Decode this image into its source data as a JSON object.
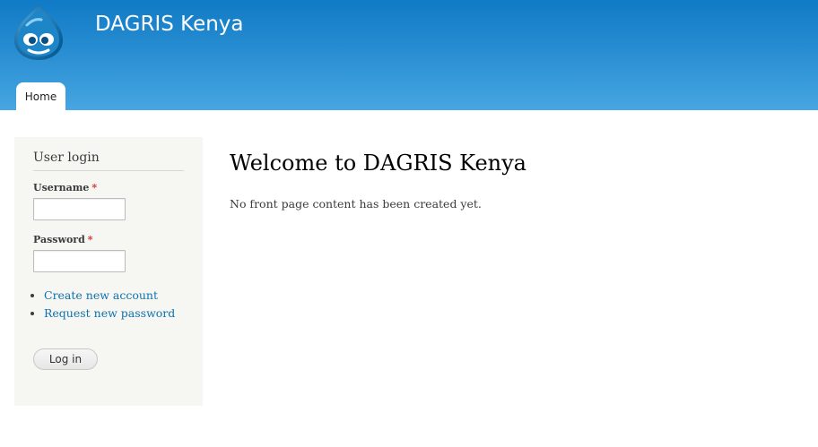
{
  "header": {
    "site_name": "DAGRIS Kenya",
    "logo_icon": "drupal-drop-icon",
    "colors": {
      "gradient_top": "#0f7ac5",
      "gradient_bottom": "#47a6e2"
    }
  },
  "nav": {
    "tabs": [
      {
        "label": "Home",
        "active": true
      }
    ]
  },
  "sidebar": {
    "login_block": {
      "title": "User login",
      "username_label": "Username",
      "password_label": "Password",
      "required_marker": "*",
      "username_value": "",
      "password_value": "",
      "links": [
        {
          "label": "Create new account"
        },
        {
          "label": "Request new password"
        }
      ],
      "submit_label": "Log in"
    }
  },
  "main": {
    "title": "Welcome to DAGRIS Kenya",
    "message": "No front page content has been created yet."
  },
  "colors": {
    "link": "#0f71ae",
    "required": "#d42f2f",
    "sidebar_bg": "#f6f6f2"
  }
}
